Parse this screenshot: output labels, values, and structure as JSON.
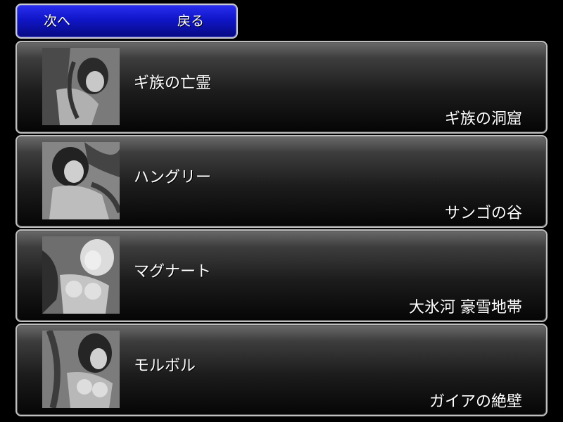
{
  "nav": {
    "next_label": "次へ",
    "back_label": "戻る"
  },
  "entries": [
    {
      "title": "ギ族の亡霊",
      "location": "ギ族の洞窟",
      "thumbnail_icon": "monster-scene-thumbnail"
    },
    {
      "title": "ハングリー",
      "location": "サンゴの谷",
      "thumbnail_icon": "monster-scene-thumbnail"
    },
    {
      "title": "マグナート",
      "location": "大氷河 豪雪地帯",
      "thumbnail_icon": "monster-scene-thumbnail"
    },
    {
      "title": "モルボル",
      "location": "ガイアの絶壁",
      "thumbnail_icon": "monster-scene-thumbnail"
    }
  ],
  "colors": {
    "nav_panel": "#1016c8",
    "entry_border": "#bfbfbf",
    "text": "#ffffff"
  }
}
